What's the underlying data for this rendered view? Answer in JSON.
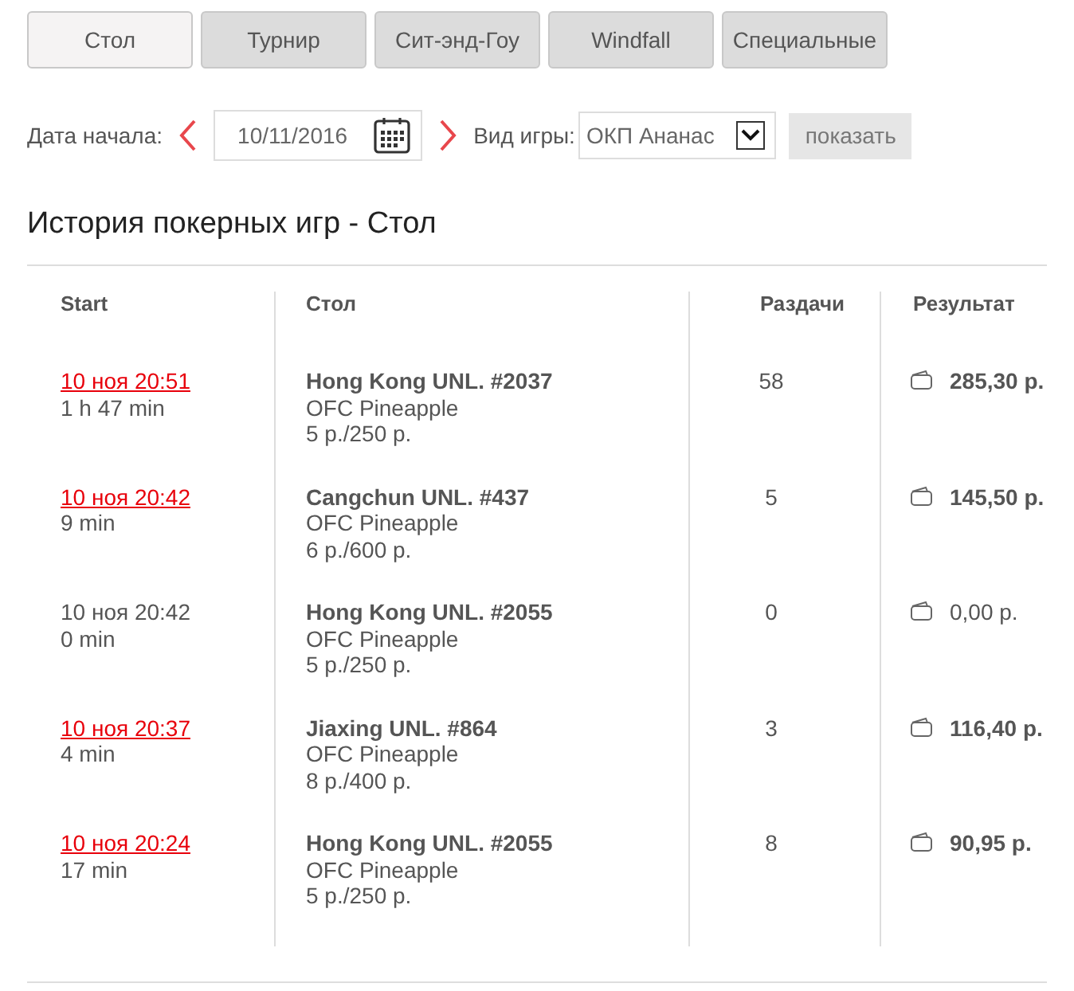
{
  "tabs": [
    {
      "label": "Стол",
      "selected": true
    },
    {
      "label": "Турнир",
      "selected": false
    },
    {
      "label": "Сит-энд-Гоу",
      "selected": false
    },
    {
      "label": "Windfall",
      "selected": false
    },
    {
      "label": "Специальные",
      "selected": false
    }
  ],
  "filters": {
    "date_label": "Дата начала:",
    "date_value": "10/11/2016",
    "game_label": "Вид игры:",
    "game_value": "ОКП Ананас",
    "show_button": "показать"
  },
  "heading": "История покерных игр - Стол",
  "table": {
    "columns": [
      "Start",
      "Стол",
      "Раздачи",
      "Результат"
    ],
    "rows": [
      {
        "start": "10 ноя 20:51",
        "linked": true,
        "duration": "1 h 47 min",
        "table": "Hong Kong UNL. #2037",
        "game": "OFC Pineapple",
        "stakes": "5 р./250 р.",
        "hands": "58",
        "result": "285,30 р.",
        "result_bold": true
      },
      {
        "start": "10 ноя 20:42",
        "linked": true,
        "duration": "9 min",
        "table": "Cangchun UNL. #437",
        "game": "OFC Pineapple",
        "stakes": "6 р./600 р.",
        "hands": "5",
        "result": "145,50 р.",
        "result_bold": true
      },
      {
        "start": "10 ноя 20:42",
        "linked": false,
        "duration": "0 min",
        "table": "Hong Kong UNL. #2055",
        "game": "OFC Pineapple",
        "stakes": "5 р./250 р.",
        "hands": "0",
        "result": "0,00 р.",
        "result_bold": false
      },
      {
        "start": "10 ноя 20:37",
        "linked": true,
        "duration": "4 min",
        "table": "Jiaxing UNL. #864",
        "game": "OFC Pineapple",
        "stakes": "8 р./400 р.",
        "hands": "3",
        "result": "116,40 р.",
        "result_bold": true
      },
      {
        "start": "10 ноя 20:24",
        "linked": true,
        "duration": "17 min",
        "table": "Hong Kong UNL. #2055",
        "game": "OFC Pineapple",
        "stakes": "5 р./250 р.",
        "hands": "8",
        "result": "90,95 р.",
        "result_bold": true
      }
    ]
  }
}
